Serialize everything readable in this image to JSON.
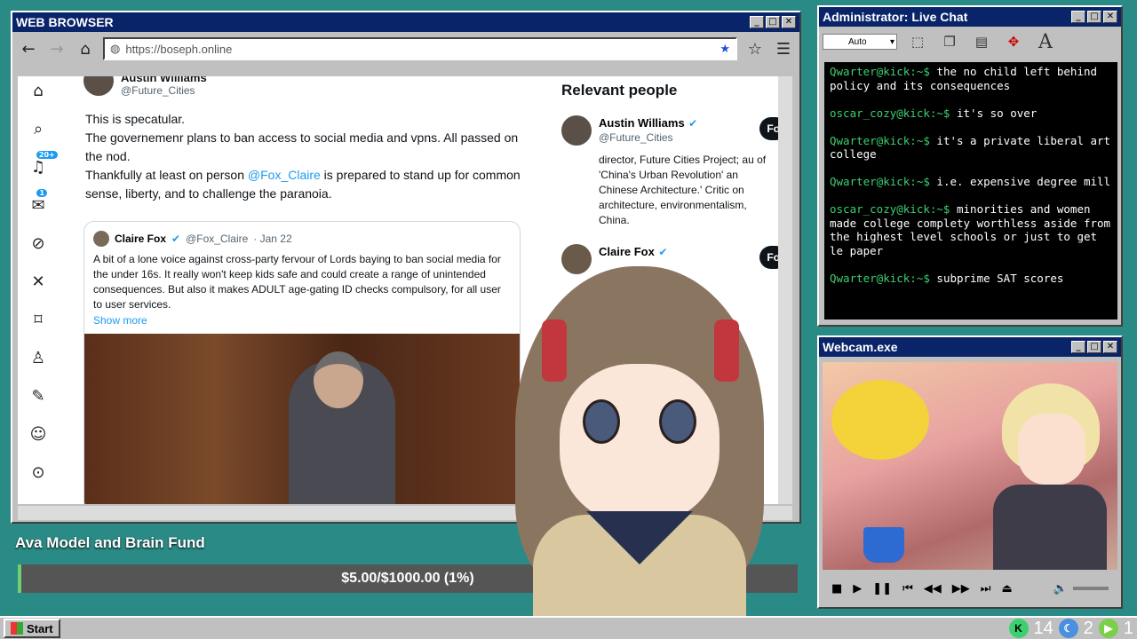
{
  "browser": {
    "title": "WEB BROWSER",
    "url": "https://boseph.online",
    "nav": {
      "back": "🡠",
      "forward": "🡢",
      "home": "⌂"
    },
    "sidebar_badges": {
      "notifications": "20+",
      "messages": "1"
    }
  },
  "post": {
    "author_name": "Austin Williams",
    "author_handle": "@Future_Cities",
    "line1": "This is specatular.",
    "line2": "The governemenr plans to ban access to social media and vpns. All passed on the nod.",
    "line3_pre": "Thankfully at least on person ",
    "mention": "@Fox_Claire",
    "line3_post": " is prepared to stand up for common sense, liberty, and to challenge the paranoia.",
    "quote": {
      "name": "Claire Fox",
      "handle": "@Fox_Claire",
      "date": "· Jan 22",
      "text": "A bit of a lone voice against cross-party fervour of Lords baying to ban social media for the under 16s. It really won't keep kids safe and could create a range of unintended consequences. But also it makes ADULT age-gating ID checks compulsory, for all user to user services.",
      "show_more": "Show more"
    }
  },
  "relevant": {
    "title": "Relevant people",
    "people": [
      {
        "name": "Austin Williams",
        "handle": "@Future_Cities",
        "bio": "director, Future Cities Project; au of 'China's Urban Revolution' an Chinese Architecture.' Critic on architecture, environmentalism, China.",
        "follow": "Fo"
      },
      {
        "name": "Claire Fox",
        "handle": "",
        "bio": "",
        "follow": "Fo"
      }
    ]
  },
  "chat": {
    "title": "Administrator: Live Chat",
    "font_select": "Auto",
    "messages": [
      {
        "user": "Qwarter@kick:~$",
        "text": " the no child left behind policy and its consequences"
      },
      {
        "user": "oscar_cozy@kick:~$",
        "text": " it's so over"
      },
      {
        "user": "Qwarter@kick:~$",
        "text": " it's a private liberal art college"
      },
      {
        "user": "Qwarter@kick:~$",
        "text": " i.e. expensive degree mill"
      },
      {
        "user": "oscar_cozy@kick:~$",
        "text": " minorities and women made college complety worthless aside from the highest level schools or just to get le paper"
      },
      {
        "user": "Qwarter@kick:~$",
        "text": " subprime SAT scores"
      }
    ]
  },
  "webcam": {
    "title": "Webcam.exe"
  },
  "fund": {
    "title": "Ava Model and Brain Fund",
    "progress_text": "$5.00/$1000.00 (1%)",
    "progress": 0.005
  },
  "taskbar": {
    "start": "Start",
    "tray": {
      "kick_count": "14",
      "moon_count": "2",
      "play_count": "1"
    }
  },
  "colors": {
    "accent": "#1d9bf0",
    "title_bar": "#0a246a",
    "desktop": "#2a8a86",
    "chat_user": "#3cd070"
  }
}
